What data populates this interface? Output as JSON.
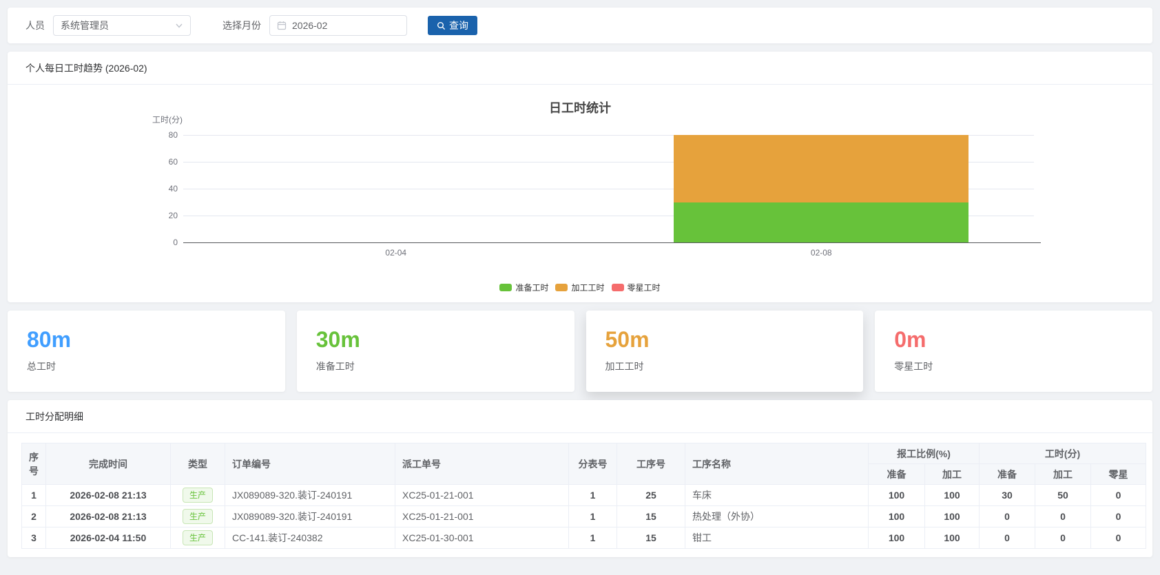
{
  "filters": {
    "person_label": "人员",
    "person_value": "系统管理员",
    "month_label": "选择月份",
    "month_value": "2026-02",
    "query_label": "查询"
  },
  "chart_card": {
    "header": "个人每日工时趋势 (2026-02)"
  },
  "chart_data": {
    "type": "bar",
    "stacked": true,
    "title": "日工时统计",
    "y_name": "工时(分)",
    "categories": [
      "02-04",
      "02-08"
    ],
    "series": [
      {
        "name": "准备工时",
        "color": "#67C23A",
        "values": [
          0,
          30
        ]
      },
      {
        "name": "加工工时",
        "color": "#E6A23C",
        "values": [
          0,
          50
        ]
      },
      {
        "name": "零星工时",
        "color": "#F56C6C",
        "values": [
          0,
          0
        ]
      }
    ],
    "ylim": [
      0,
      80
    ],
    "yticks": [
      0,
      20,
      40,
      60,
      80
    ],
    "grid": true,
    "legend_position": "bottom"
  },
  "stats": [
    {
      "value": "80m",
      "label": "总工时",
      "color": "#409EFF"
    },
    {
      "value": "30m",
      "label": "准备工时",
      "color": "#67C23A"
    },
    {
      "value": "50m",
      "label": "加工工时",
      "color": "#E6A23C"
    },
    {
      "value": "0m",
      "label": "零星工时",
      "color": "#F56C6C"
    }
  ],
  "table": {
    "header": "工时分配明细",
    "columns": {
      "seq": "序号",
      "time": "完成时间",
      "type": "类型",
      "order_no": "订单编号",
      "dispatch_no": "派工单号",
      "sub_no": "分表号",
      "op_no": "工序号",
      "op_name": "工序名称",
      "ratio_group": "报工比例(%)",
      "minutes_group": "工时(分)",
      "prep": "准备",
      "proc": "加工",
      "misc": "零星"
    },
    "rows": [
      {
        "seq": "1",
        "time": "2026-02-08 21:13",
        "type": "生产",
        "order_no": "JX089089-320.装订-240191",
        "dispatch_no": "XC25-01-21-001",
        "sub_no": "1",
        "op_no": "25",
        "op_name": "车床",
        "ratio_prep": "100",
        "ratio_proc": "100",
        "min_prep": "30",
        "min_proc": "50",
        "min_misc": "0"
      },
      {
        "seq": "2",
        "time": "2026-02-08 21:13",
        "type": "生产",
        "order_no": "JX089089-320.装订-240191",
        "dispatch_no": "XC25-01-21-001",
        "sub_no": "1",
        "op_no": "15",
        "op_name": "热处理（外协）",
        "ratio_prep": "100",
        "ratio_proc": "100",
        "min_prep": "0",
        "min_proc": "0",
        "min_misc": "0"
      },
      {
        "seq": "3",
        "time": "2026-02-04 11:50",
        "type": "生产",
        "order_no": "CC-141.装订-240382",
        "dispatch_no": "XC25-01-30-001",
        "sub_no": "1",
        "op_no": "15",
        "op_name": "钳工",
        "ratio_prep": "100",
        "ratio_proc": "100",
        "min_prep": "0",
        "min_proc": "0",
        "min_misc": "0"
      }
    ]
  },
  "colors": {
    "query_button": "#1a62ac",
    "page_background": "#f0f2f5",
    "badge_text": "#67C23A",
    "badge_background": "#f0f9eb",
    "badge_border": "#c7e6b5",
    "axis_text": "#6e7079",
    "gridline": "#e4e7f0"
  }
}
